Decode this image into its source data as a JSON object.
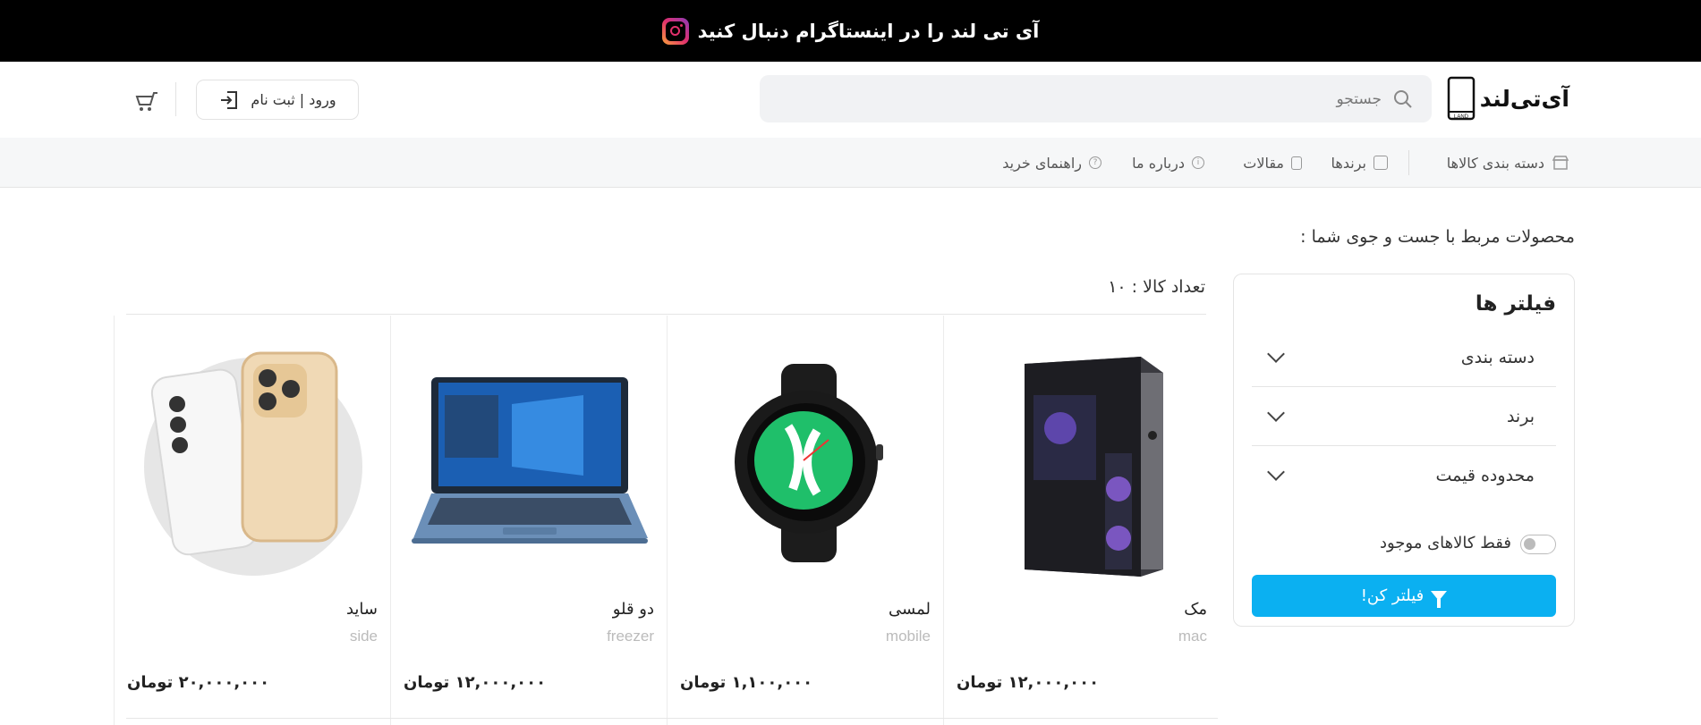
{
  "banner": {
    "text": "آی تی لند را در اینستاگرام دنبال کنید",
    "icon": "instagram-icon"
  },
  "header": {
    "logo_text": "آی‌تی‌لند",
    "search_placeholder": "جستجو",
    "login_label": "ورود | ثبت نام",
    "cart_icon": "cart-icon"
  },
  "nav": {
    "categories": "دسته بندی کالاها",
    "brands": "برندها",
    "articles": "مقالات",
    "about": "درباره ما",
    "guide": "راهنمای خرید"
  },
  "main": {
    "results_title": "محصولات مربط با جست و جوی شما :",
    "count_label": "تعداد کالا : ۱۰"
  },
  "filters": {
    "title": "فیلتر ها",
    "rows": [
      {
        "label": "دسته بندی"
      },
      {
        "label": "برند"
      },
      {
        "label": "محدوده قیمت"
      }
    ],
    "available_only": "فقط کالاهای موجود",
    "button": "فیلتر کن!"
  },
  "products": [
    {
      "name": "مک",
      "slug": "mac",
      "price": "۱۲,۰۰۰,۰۰۰ تومان"
    },
    {
      "name": "لمسی",
      "slug": "mobile",
      "price": "۱,۱۰۰,۰۰۰ تومان"
    },
    {
      "name": "دو قلو",
      "slug": "freezer",
      "price": "۱۲,۰۰۰,۰۰۰ تومان"
    },
    {
      "name": "ساید",
      "slug": "side",
      "price": "۲۰,۰۰۰,۰۰۰ تومان"
    }
  ],
  "colors": {
    "accent": "#0bb0f1",
    "banner_bg": "#000000"
  }
}
